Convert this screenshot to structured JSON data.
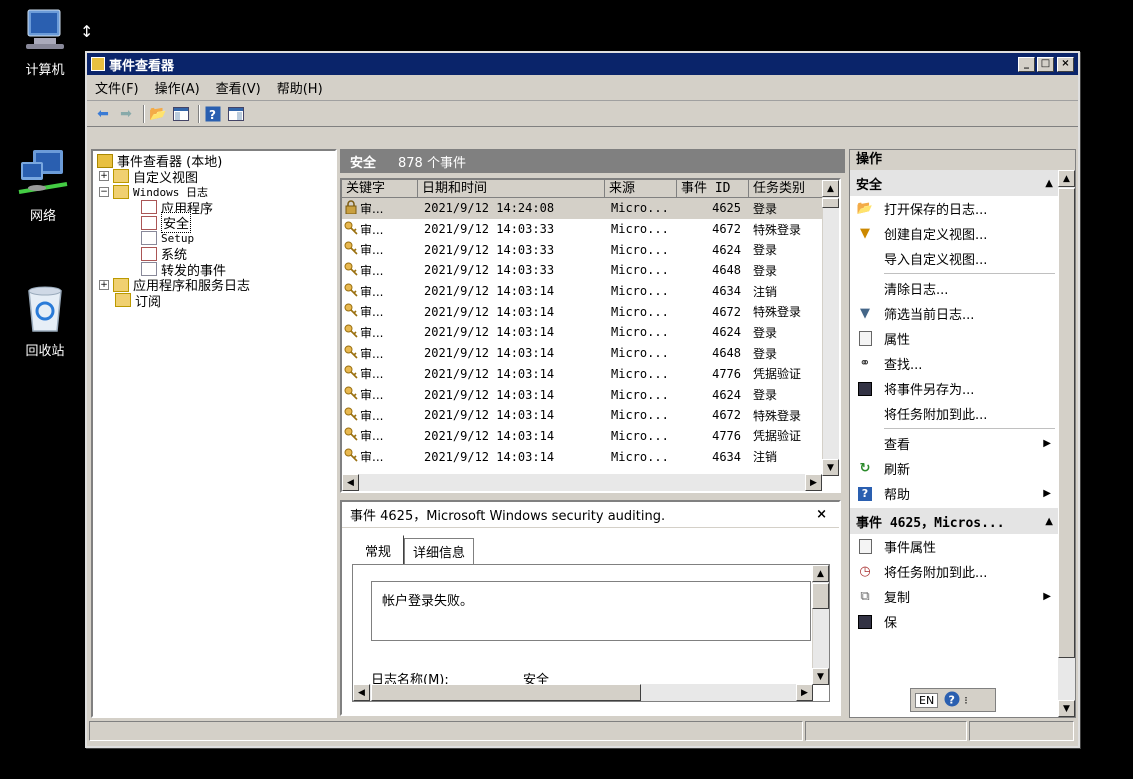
{
  "desktop": {
    "icons": [
      {
        "label": "计算机",
        "icon": "computer-icon"
      },
      {
        "label": "网络",
        "icon": "network-icon"
      },
      {
        "label": "回收站",
        "icon": "recycle-bin-icon"
      }
    ]
  },
  "window": {
    "title": "事件查看器",
    "controls": {
      "minimize": "_",
      "maximize": "□",
      "close": "×"
    }
  },
  "menu": [
    "文件(F)",
    "操作(A)",
    "查看(V)",
    "帮助(H)"
  ],
  "toolbar": [
    "back-icon",
    "forward-icon",
    "up-icon",
    "show-hide-console-tree-icon",
    "help-icon",
    "show-hide-action-pane-icon"
  ],
  "tree": {
    "root": "事件查看器 (本地)",
    "custom_views": "自定义视图",
    "windows_logs": "Windows 日志",
    "application": "应用程序",
    "security": "安全",
    "setup": "Setup",
    "system": "系统",
    "forwarded": "转发的事件",
    "app_services": "应用程序和服务日志",
    "subscriptions": "订阅"
  },
  "log": {
    "name": "安全",
    "count": "878 个事件",
    "columns": [
      "关键字",
      "日期和时间",
      "来源",
      "事件 ID",
      "任务类别"
    ],
    "rows": [
      {
        "kw": "审...",
        "dt": "2021/9/12 14:24:08",
        "src": "Micro...",
        "id": "4625",
        "task": "登录",
        "icon": "lock"
      },
      {
        "kw": "审...",
        "dt": "2021/9/12 14:03:33",
        "src": "Micro...",
        "id": "4672",
        "task": "特殊登录",
        "icon": "key"
      },
      {
        "kw": "审...",
        "dt": "2021/9/12 14:03:33",
        "src": "Micro...",
        "id": "4624",
        "task": "登录",
        "icon": "key"
      },
      {
        "kw": "审...",
        "dt": "2021/9/12 14:03:33",
        "src": "Micro...",
        "id": "4648",
        "task": "登录",
        "icon": "key"
      },
      {
        "kw": "审...",
        "dt": "2021/9/12 14:03:14",
        "src": "Micro...",
        "id": "4634",
        "task": "注销",
        "icon": "key"
      },
      {
        "kw": "审...",
        "dt": "2021/9/12 14:03:14",
        "src": "Micro...",
        "id": "4672",
        "task": "特殊登录",
        "icon": "key"
      },
      {
        "kw": "审...",
        "dt": "2021/9/12 14:03:14",
        "src": "Micro...",
        "id": "4624",
        "task": "登录",
        "icon": "key"
      },
      {
        "kw": "审...",
        "dt": "2021/9/12 14:03:14",
        "src": "Micro...",
        "id": "4648",
        "task": "登录",
        "icon": "key"
      },
      {
        "kw": "审...",
        "dt": "2021/9/12 14:03:14",
        "src": "Micro...",
        "id": "4776",
        "task": "凭据验证",
        "icon": "key"
      },
      {
        "kw": "审...",
        "dt": "2021/9/12 14:03:14",
        "src": "Micro...",
        "id": "4624",
        "task": "登录",
        "icon": "key"
      },
      {
        "kw": "审...",
        "dt": "2021/9/12 14:03:14",
        "src": "Micro...",
        "id": "4672",
        "task": "特殊登录",
        "icon": "key"
      },
      {
        "kw": "审...",
        "dt": "2021/9/12 14:03:14",
        "src": "Micro...",
        "id": "4776",
        "task": "凭据验证",
        "icon": "key"
      },
      {
        "kw": "审...",
        "dt": "2021/9/12 14:03:14",
        "src": "Micro...",
        "id": "4634",
        "task": "注销",
        "icon": "key"
      }
    ]
  },
  "detail": {
    "header": "事件 4625，Microsoft Windows security auditing.",
    "close": "×",
    "tabs": [
      "常规",
      "详细信息"
    ],
    "message": "帐户登录失败。",
    "field_label": "日志名称(M):",
    "field_value": "安全"
  },
  "actions": {
    "title": "操作",
    "section1": "安全",
    "items1": [
      {
        "label": "打开保存的日志...",
        "icon": "open-log-icon"
      },
      {
        "label": "创建自定义视图...",
        "icon": "filter-create-icon"
      },
      {
        "label": "导入自定义视图...",
        "icon": ""
      },
      {
        "label": "清除日志...",
        "icon": ""
      },
      {
        "label": "筛选当前日志...",
        "icon": "filter-icon"
      },
      {
        "label": "属性",
        "icon": "properties-icon"
      },
      {
        "label": "查找...",
        "icon": "binoculars-icon"
      },
      {
        "label": "将事件另存为...",
        "icon": "save-icon"
      },
      {
        "label": "将任务附加到此...",
        "icon": ""
      },
      {
        "label": "查看",
        "icon": "",
        "submenu": true
      },
      {
        "label": "刷新",
        "icon": "refresh-icon"
      },
      {
        "label": "帮助",
        "icon": "help-icon",
        "submenu": true
      }
    ],
    "section2": "事件 4625，Micros...",
    "items2": [
      {
        "label": "事件属性",
        "icon": "properties-icon"
      },
      {
        "label": "将任务附加到此...",
        "icon": "task-icon"
      },
      {
        "label": "复制",
        "icon": "copy-icon",
        "submenu": true
      },
      {
        "label": "保",
        "icon": "save-icon"
      }
    ]
  },
  "langbar": {
    "lang": "EN"
  }
}
